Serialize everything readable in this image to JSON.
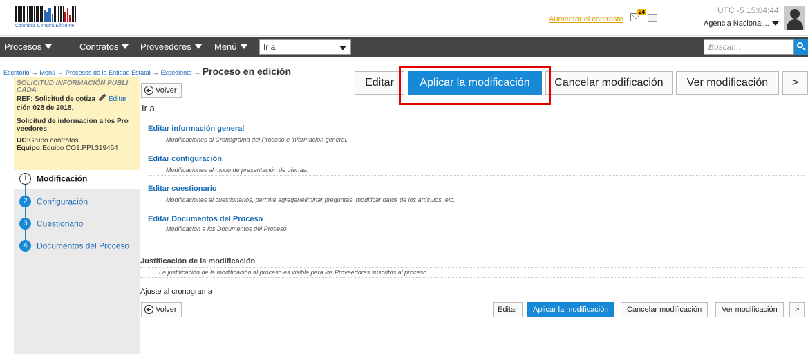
{
  "header": {
    "logo_caption": "Colombia Compra Eficiente",
    "contrast_link": "Aumentar el contraste",
    "message_count": "24",
    "utc": "UTC -5 15:04:44",
    "agency": "Agencia Nacional..."
  },
  "nav": {
    "items": [
      "Procesos",
      "Contratos",
      "Proveedores",
      "Menú"
    ],
    "goto_value": "Ir a",
    "search_placeholder": "Buscar..."
  },
  "breadcrumb": {
    "items": [
      "Escritorio",
      "Menú",
      "Procesos de la Entidad Estatal",
      "Expediente"
    ],
    "current": "Proceso en edición"
  },
  "top_actions": {
    "edit": "Editar",
    "apply": "Aplicar la modificación",
    "cancel": "Cancelar modificación",
    "view": "Ver modificación",
    "next": ">"
  },
  "info": {
    "title_line1": "SOLICITUD INFORMACIÓN PUBLI",
    "title_line2": "CADA",
    "ref_line1": "REF: Solicitud de cotiza",
    "ref_edit": "Editar",
    "ref_line2": "ción 028 de 2018.",
    "desc_line1": "Solicitud de información a los Pro",
    "desc_line2": "veedores",
    "uc_label": "UC:",
    "uc_value": "Grupo contratos",
    "team_label": "Equipo:",
    "team_value": "Equipo CO1.PPI.319454"
  },
  "steps": [
    {
      "num": "1",
      "label": "Modificación"
    },
    {
      "num": "2",
      "label": "Configuración"
    },
    {
      "num": "3",
      "label": "Cuestionario"
    },
    {
      "num": "4",
      "label": "Documentos del Proceso"
    }
  ],
  "main": {
    "back": "Volver",
    "section_title": "Ir a",
    "links": [
      {
        "title": "Editar información general",
        "desc": "Modificaciones al Cronograma del Proceso e información general."
      },
      {
        "title": "Editar configuración",
        "desc": "Modificaciones al modo de presentación de ofertas."
      },
      {
        "title": "Editar cuestionario",
        "desc": "Modificaciones al cuestionarios, permite agregar/eliminar preguntas, modificar datos de los artículos, etc."
      },
      {
        "title": "Editar Documentos del Proceso",
        "desc": "Modificación a los Documentos del Proceso"
      }
    ],
    "justification_title": "Justificación de la modificación",
    "justification_desc": "La justificación de la modificación al proceso es visible para los Proveedores suscritos al proceso.",
    "schedule_label": "Ajuste al cronograma"
  },
  "bottom_actions": {
    "back": "Volver",
    "edit": "Editar",
    "apply": "Aplicar la modificación",
    "cancel": "Cancelar modificación",
    "view": "Ver modificación",
    "next": ">"
  },
  "colors": {
    "accent": "#1789d6",
    "navbar": "#454545",
    "info_bg": "#fdf3c0",
    "highlight": "#e00000"
  }
}
